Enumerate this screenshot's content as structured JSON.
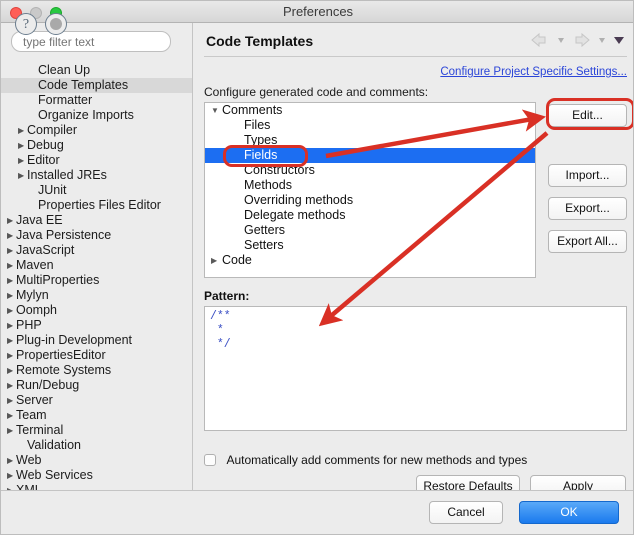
{
  "window": {
    "title": "Preferences",
    "controls": [
      "close",
      "minimize",
      "maximize"
    ]
  },
  "sidebar": {
    "filter_placeholder": "type filter text",
    "items": [
      {
        "label": "Clean Up",
        "indent": 2,
        "arrow": "",
        "selected": false
      },
      {
        "label": "Code Templates",
        "indent": 2,
        "arrow": "",
        "selected": true
      },
      {
        "label": "Formatter",
        "indent": 2,
        "arrow": "",
        "selected": false
      },
      {
        "label": "Organize Imports",
        "indent": 2,
        "arrow": "",
        "selected": false
      },
      {
        "label": "Compiler",
        "indent": 1,
        "arrow": "▶",
        "selected": false
      },
      {
        "label": "Debug",
        "indent": 1,
        "arrow": "▶",
        "selected": false
      },
      {
        "label": "Editor",
        "indent": 1,
        "arrow": "▶",
        "selected": false
      },
      {
        "label": "Installed JREs",
        "indent": 1,
        "arrow": "▶",
        "selected": false
      },
      {
        "label": "JUnit",
        "indent": 2,
        "arrow": "",
        "selected": false
      },
      {
        "label": "Properties Files Editor",
        "indent": 2,
        "arrow": "",
        "selected": false
      },
      {
        "label": "Java EE",
        "indent": 0,
        "arrow": "▶",
        "selected": false
      },
      {
        "label": "Java Persistence",
        "indent": 0,
        "arrow": "▶",
        "selected": false
      },
      {
        "label": "JavaScript",
        "indent": 0,
        "arrow": "▶",
        "selected": false
      },
      {
        "label": "Maven",
        "indent": 0,
        "arrow": "▶",
        "selected": false
      },
      {
        "label": "MultiProperties",
        "indent": 0,
        "arrow": "▶",
        "selected": false
      },
      {
        "label": "Mylyn",
        "indent": 0,
        "arrow": "▶",
        "selected": false
      },
      {
        "label": "Oomph",
        "indent": 0,
        "arrow": "▶",
        "selected": false
      },
      {
        "label": "PHP",
        "indent": 0,
        "arrow": "▶",
        "selected": false
      },
      {
        "label": "Plug-in Development",
        "indent": 0,
        "arrow": "▶",
        "selected": false
      },
      {
        "label": "PropertiesEditor",
        "indent": 0,
        "arrow": "▶",
        "selected": false
      },
      {
        "label": "Remote Systems",
        "indent": 0,
        "arrow": "▶",
        "selected": false
      },
      {
        "label": "Run/Debug",
        "indent": 0,
        "arrow": "▶",
        "selected": false
      },
      {
        "label": "Server",
        "indent": 0,
        "arrow": "▶",
        "selected": false
      },
      {
        "label": "Team",
        "indent": 0,
        "arrow": "▶",
        "selected": false
      },
      {
        "label": "Terminal",
        "indent": 0,
        "arrow": "▶",
        "selected": false
      },
      {
        "label": "Validation",
        "indent": 1,
        "arrow": "",
        "selected": false
      },
      {
        "label": "Web",
        "indent": 0,
        "arrow": "▶",
        "selected": false
      },
      {
        "label": "Web Services",
        "indent": 0,
        "arrow": "▶",
        "selected": false
      },
      {
        "label": "XML",
        "indent": 0,
        "arrow": "▶",
        "selected": false
      }
    ]
  },
  "main": {
    "page_title": "Code Templates",
    "project_settings_link": "Configure Project Specific Settings...",
    "configure_label": "Configure generated code and comments:",
    "tree": [
      {
        "label": "Comments",
        "indent": 0,
        "caret": "▼",
        "selected": false
      },
      {
        "label": "Files",
        "indent": 1,
        "caret": "",
        "selected": false
      },
      {
        "label": "Types",
        "indent": 1,
        "caret": "",
        "selected": false
      },
      {
        "label": "Fields",
        "indent": 1,
        "caret": "",
        "selected": true
      },
      {
        "label": "Constructors",
        "indent": 1,
        "caret": "",
        "selected": false
      },
      {
        "label": "Methods",
        "indent": 1,
        "caret": "",
        "selected": false
      },
      {
        "label": "Overriding methods",
        "indent": 1,
        "caret": "",
        "selected": false
      },
      {
        "label": "Delegate methods",
        "indent": 1,
        "caret": "",
        "selected": false
      },
      {
        "label": "Getters",
        "indent": 1,
        "caret": "",
        "selected": false
      },
      {
        "label": "Setters",
        "indent": 1,
        "caret": "",
        "selected": false
      },
      {
        "label": "Code",
        "indent": 0,
        "caret": "▶",
        "selected": false
      }
    ],
    "buttons": {
      "edit": "Edit...",
      "import": "Import...",
      "export": "Export...",
      "export_all": "Export All..."
    },
    "pattern_label": "Pattern:",
    "pattern_value": "/**\n *\n */",
    "auto_comments_label": "Automatically add comments for new methods and types",
    "auto_comments_checked": false,
    "restore_defaults": "Restore Defaults",
    "apply": "Apply"
  },
  "footer": {
    "cancel": "Cancel",
    "ok": "OK"
  },
  "annotations": {
    "highlight_color": "#d93025",
    "shapes": [
      "rect-around-fields",
      "rect-around-edit",
      "arrow-fields-to-edit",
      "arrow-edit-to-pattern"
    ]
  },
  "colors": {
    "selection_blue": "#1c6ef2",
    "link_blue": "#2b45d8",
    "ok_button_blue": "#1a7aee",
    "pattern_text": "#3b4fc4",
    "annotation_red": "#d93025"
  }
}
